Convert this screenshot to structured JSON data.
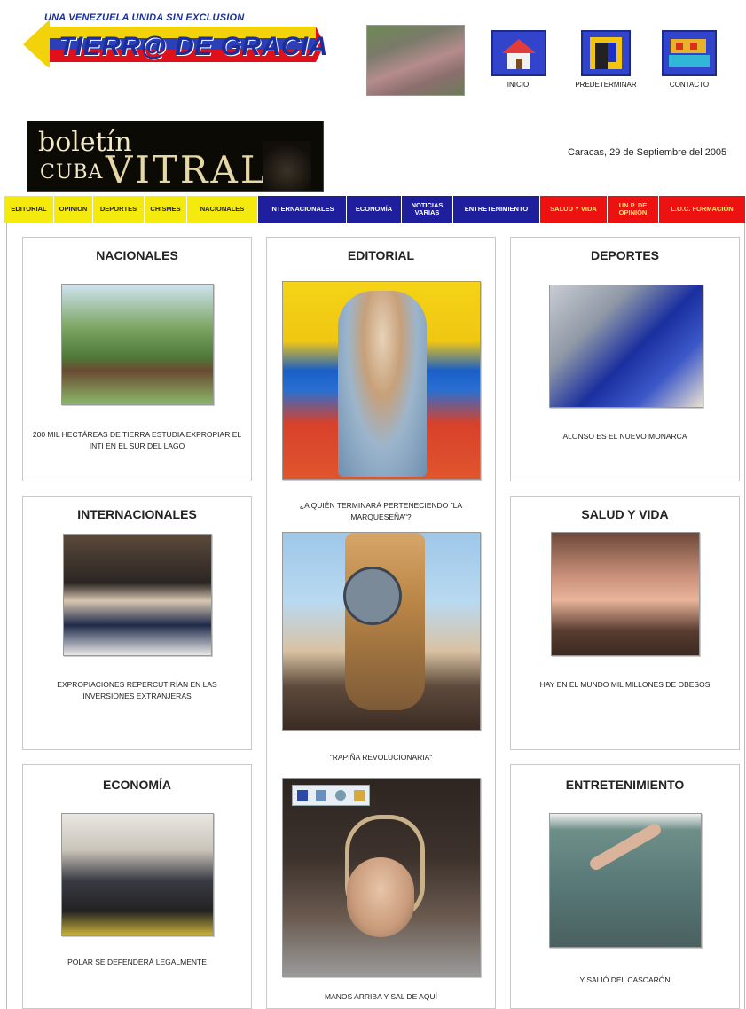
{
  "header": {
    "banner_top": "UNA VENEZUELA UNIDA SIN EXCLUSION",
    "banner_main": "TIERR@ DE GRACIA",
    "icons": [
      {
        "label": "INICIO",
        "icon": "house-icon"
      },
      {
        "label": "PREDETERMINAR",
        "icon": "door-icon"
      },
      {
        "label": "CONTACTO",
        "icon": "desk-icon"
      }
    ]
  },
  "vitral": {
    "boletin": "boletín",
    "cuba": "CUBA",
    "word": "VITRAL"
  },
  "date": "Caracas, 29 de Septiembre del 2005",
  "nav": [
    {
      "label": "EDITORIAL",
      "color": "yellow"
    },
    {
      "label": "OPINION",
      "color": "yellow"
    },
    {
      "label": "DEPORTES",
      "color": "yellow"
    },
    {
      "label": "CHISMES",
      "color": "yellow"
    },
    {
      "label": "NACIONALES",
      "color": "yellow"
    },
    {
      "label": "INTERNACIONALES",
      "color": "blue"
    },
    {
      "label": "ECONOMÍA",
      "color": "blue"
    },
    {
      "label": "NOTICIAS VARIAS",
      "color": "blue"
    },
    {
      "label": "ENTRETENIMIENTO",
      "color": "blue"
    },
    {
      "label": "SALUD Y VIDA",
      "color": "red"
    },
    {
      "label": "UN P. DE OPINIÓN",
      "color": "red"
    },
    {
      "label": "L.O.C. FORMACIÓN",
      "color": "red"
    }
  ],
  "sections": {
    "nacionales": {
      "title": "NACIONALES",
      "caption": "200 MIL HECTÁREAS DE TIERRA ESTUDIA EXPROPIAR EL INTI EN EL SUR DEL LAGO"
    },
    "editorial": {
      "title": "EDITORIAL"
    },
    "deportes": {
      "title": "DEPORTES",
      "caption": "ALONSO ES EL NUEVO MONARCA"
    },
    "internacionales": {
      "title": "INTERNACIONALES",
      "caption": "EXPROPIACIONES REPERCUTIRÍAN EN LAS INVERSIONES EXTRANJERAS"
    },
    "salud": {
      "title": "SALUD Y VIDA",
      "caption": "HAY EN EL MUNDO MIL MILLONES DE OBESOS"
    },
    "economia": {
      "title": "ECONOMÍA",
      "caption": "POLAR SE DEFENDERÁ LEGALMENTE"
    },
    "entretenimiento": {
      "title": "ENTRETENIMIENTO",
      "caption": "Y SALIÓ DEL CASCARÓN"
    }
  },
  "editorial_items": [
    "¿A QUIÉN TERMINARÁ PERTENECIENDO \"LA MARQUESEÑA\"?",
    "\"RAPIÑA REVOLUCIONARIA\"",
    "MANOS ARRIBA Y SAL DE AQUÍ"
  ],
  "colors": {
    "nav_yellow": "#f4ea0d",
    "nav_blue": "#1f1e9c",
    "nav_red": "#ee1111",
    "banner_blue": "#1b2f9c"
  }
}
